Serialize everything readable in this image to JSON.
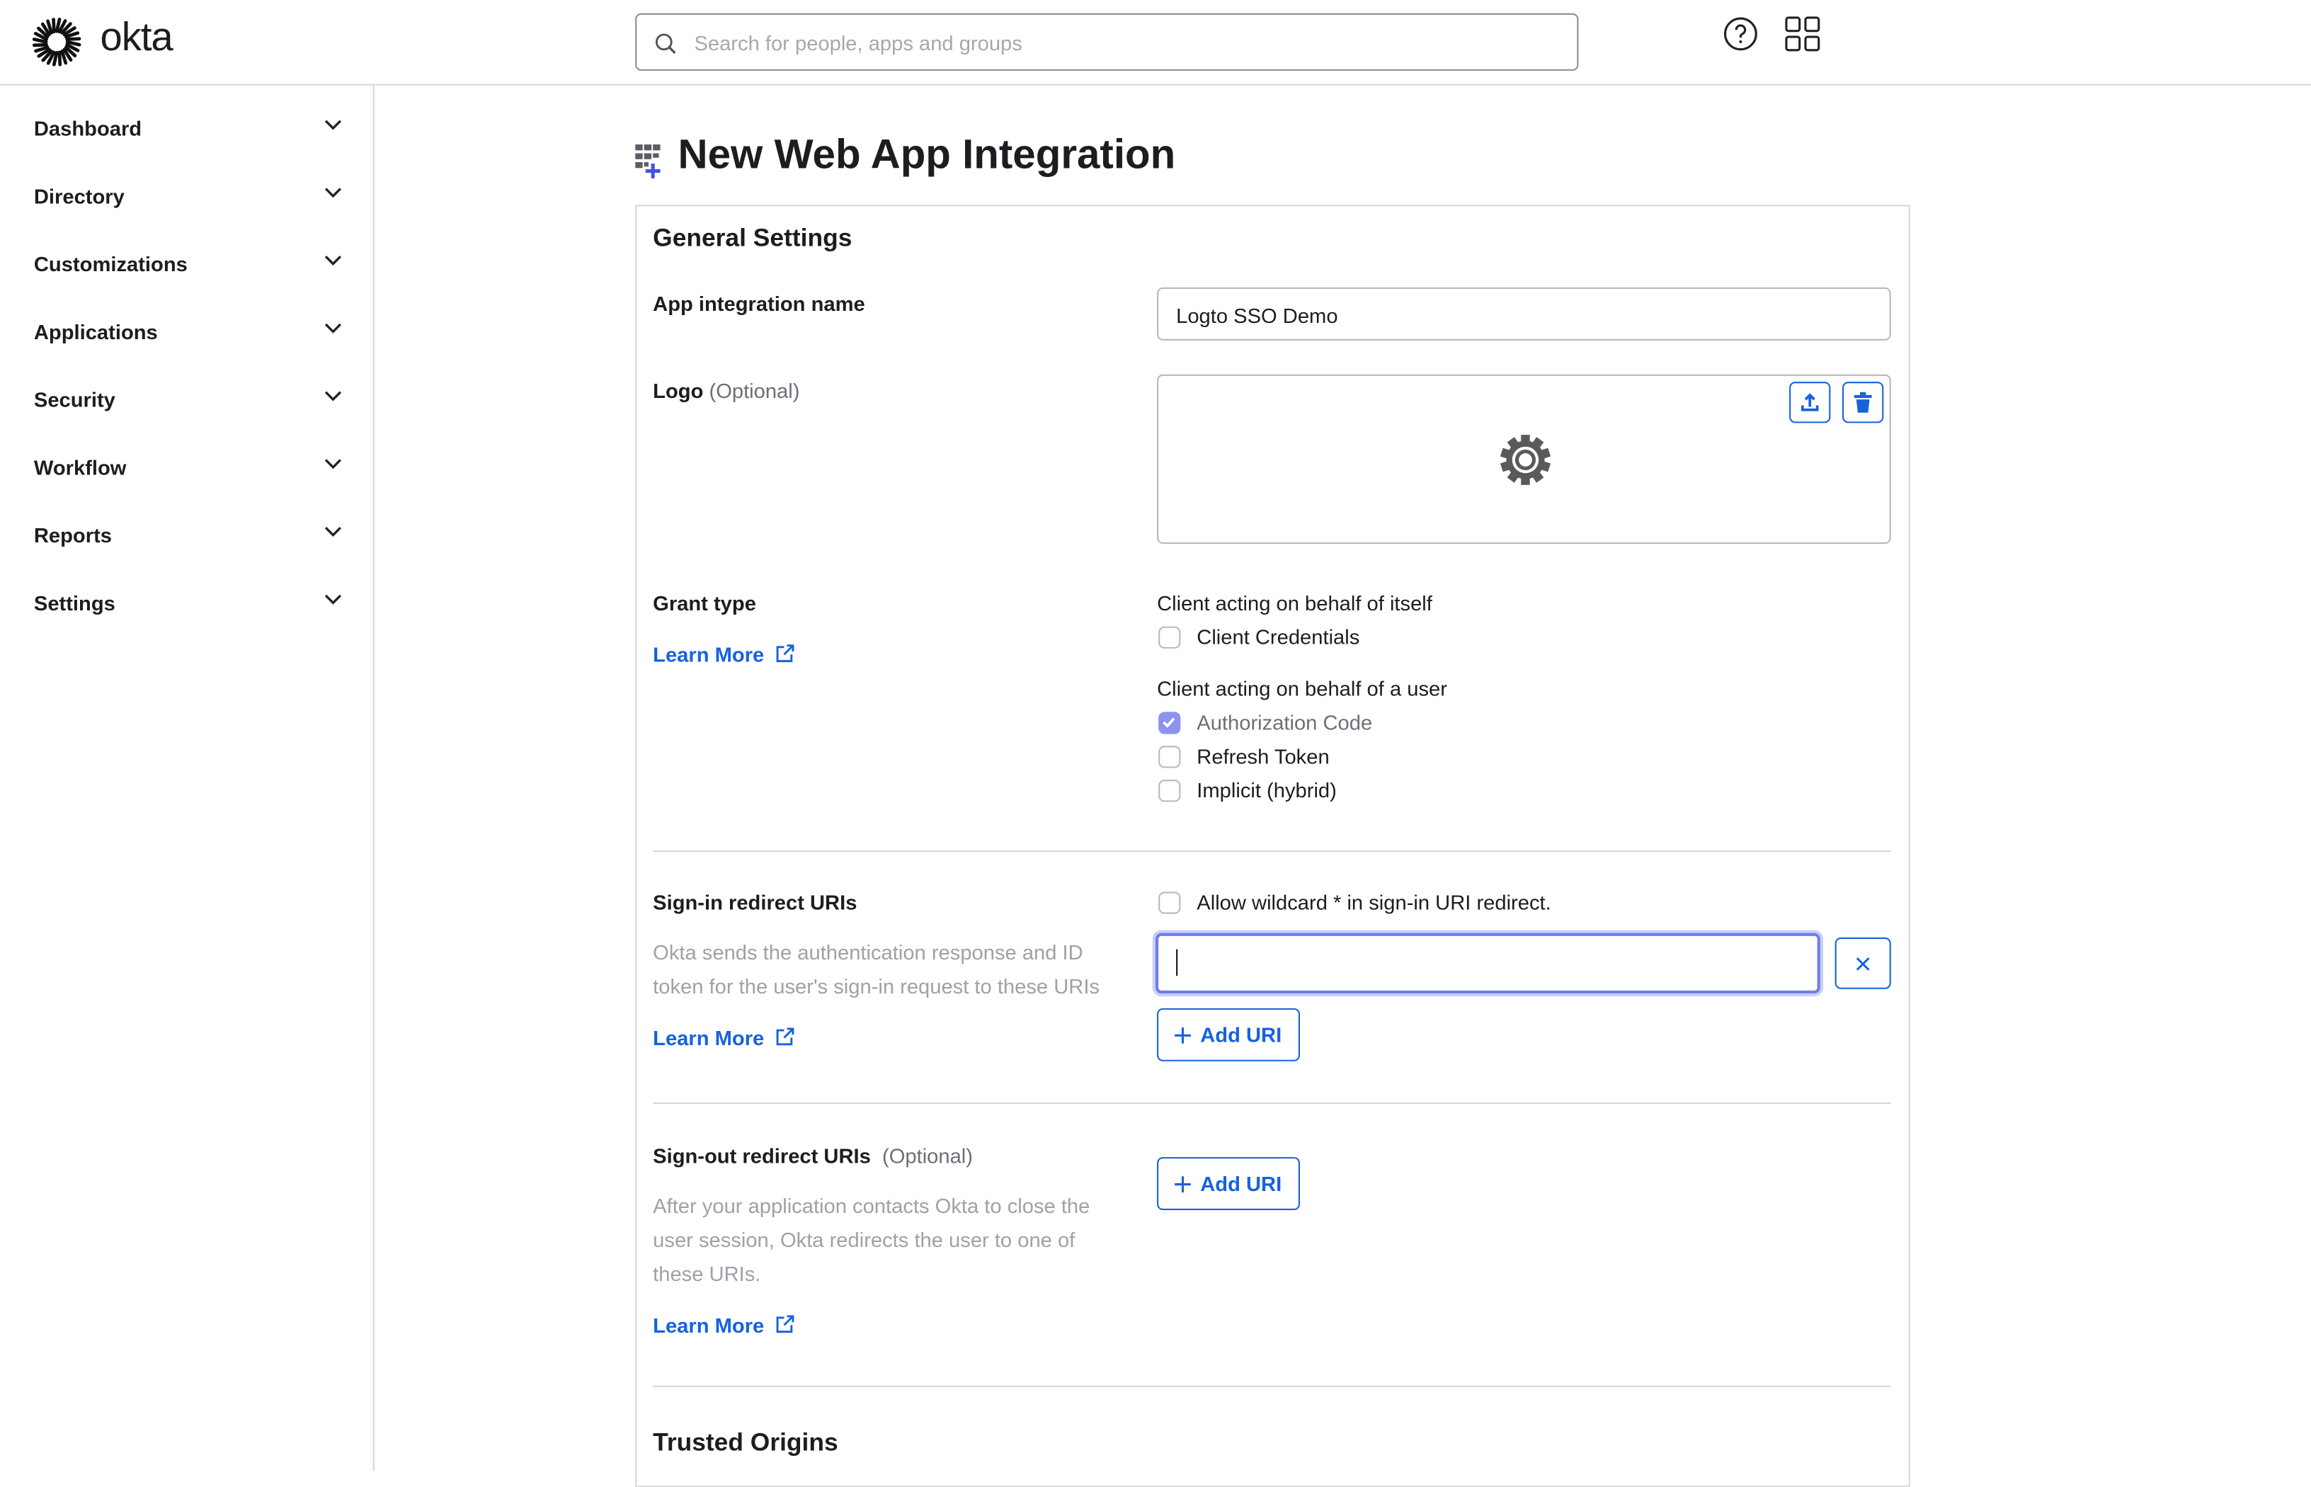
{
  "header": {
    "brand": "okta",
    "search_placeholder": "Search for people, apps and groups",
    "icons": [
      "okta-logo-icon",
      "search-icon",
      "help-icon",
      "app-grid-icon"
    ]
  },
  "sidebar": {
    "items": [
      {
        "label": "Dashboard"
      },
      {
        "label": "Directory"
      },
      {
        "label": "Customizations"
      },
      {
        "label": "Applications"
      },
      {
        "label": "Security"
      },
      {
        "label": "Workflow"
      },
      {
        "label": "Reports"
      },
      {
        "label": "Settings"
      }
    ]
  },
  "page": {
    "title": "New Web App Integration",
    "section_title": "General Settings",
    "app_name": {
      "label": "App integration name",
      "value": "Logto SSO Demo"
    },
    "logo": {
      "label": "Logo",
      "optional": "(Optional)"
    },
    "grant_type": {
      "label": "Grant type",
      "learn_more": "Learn More",
      "group1_label": "Client acting on behalf of itself",
      "group1_options": [
        {
          "label": "Client Credentials",
          "checked": false
        }
      ],
      "group2_label": "Client acting on behalf of a user",
      "group2_options": [
        {
          "label": "Authorization Code",
          "checked": true
        },
        {
          "label": "Refresh Token",
          "checked": false
        },
        {
          "label": "Implicit (hybrid)",
          "checked": false
        }
      ]
    },
    "signin": {
      "label": "Sign-in redirect URIs",
      "description_line1": "Okta sends the authentication response and ID",
      "description_line2": "token for the user's sign-in request to these URIs",
      "learn_more": "Learn More",
      "wildcard_label": "Allow wildcard * in sign-in URI redirect.",
      "uri_value": "",
      "add_uri": "Add URI"
    },
    "signout": {
      "label": "Sign-out redirect URIs",
      "optional": "(Optional)",
      "description_line1": "After your application contacts Okta to close the",
      "description_line2": "user session, Okta redirects the user to one of",
      "description_line3": "these URIs.",
      "learn_more": "Learn More",
      "add_uri": "Add URI"
    },
    "trusted_origins": "Trusted Origins"
  },
  "colors": {
    "accent": "#1662dd",
    "checkbox_checked": "#8b93ee",
    "focus_ring": "#6f7fe8"
  }
}
